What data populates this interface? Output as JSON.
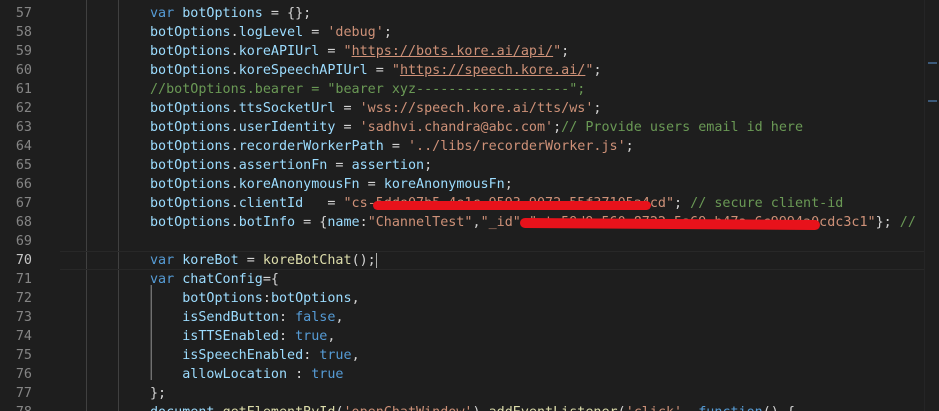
{
  "editor": {
    "first_line_number": 57,
    "active_line": 70,
    "lines": [
      {
        "n": "57",
        "tokens": [
          [
            "kw",
            "var"
          ],
          [
            "plain",
            " "
          ],
          [
            "var",
            "botOptions"
          ],
          [
            "plain",
            " = {};"
          ]
        ]
      },
      {
        "n": "58",
        "tokens": [
          [
            "var",
            "botOptions"
          ],
          [
            "plain",
            "."
          ],
          [
            "var",
            "logLevel"
          ],
          [
            "plain",
            " = "
          ],
          [
            "str",
            "'debug'"
          ],
          [
            "plain",
            ";"
          ]
        ]
      },
      {
        "n": "59",
        "tokens": [
          [
            "var",
            "botOptions"
          ],
          [
            "plain",
            "."
          ],
          [
            "var",
            "koreAPIUrl"
          ],
          [
            "plain",
            " = "
          ],
          [
            "str",
            "\""
          ],
          [
            "strurl",
            "https://bots.kore.ai/api/"
          ],
          [
            "str",
            "\""
          ],
          [
            "plain",
            ";"
          ]
        ]
      },
      {
        "n": "60",
        "tokens": [
          [
            "var",
            "botOptions"
          ],
          [
            "plain",
            "."
          ],
          [
            "var",
            "koreSpeechAPIUrl"
          ],
          [
            "plain",
            " = "
          ],
          [
            "str",
            "\""
          ],
          [
            "strurl",
            "https://speech.kore.ai/"
          ],
          [
            "str",
            "\""
          ],
          [
            "plain",
            ";"
          ]
        ]
      },
      {
        "n": "61",
        "tokens": [
          [
            "cmt",
            "//botOptions.bearer = \"bearer xyz-------------------\";"
          ]
        ]
      },
      {
        "n": "62",
        "tokens": [
          [
            "var",
            "botOptions"
          ],
          [
            "plain",
            "."
          ],
          [
            "var",
            "ttsSocketUrl"
          ],
          [
            "plain",
            " = "
          ],
          [
            "str",
            "'wss://speech.kore.ai/tts/ws'"
          ],
          [
            "plain",
            ";"
          ]
        ]
      },
      {
        "n": "63",
        "tokens": [
          [
            "var",
            "botOptions"
          ],
          [
            "plain",
            "."
          ],
          [
            "var",
            "userIdentity"
          ],
          [
            "plain",
            " = "
          ],
          [
            "str",
            "'sadhvi.chandra@abc.com'"
          ],
          [
            "plain",
            ";"
          ],
          [
            "cmt",
            "// Provide users email id here"
          ]
        ]
      },
      {
        "n": "64",
        "tokens": [
          [
            "var",
            "botOptions"
          ],
          [
            "plain",
            "."
          ],
          [
            "var",
            "recorderWorkerPath"
          ],
          [
            "plain",
            " = "
          ],
          [
            "str",
            "'../libs/recorderWorker.js'"
          ],
          [
            "plain",
            ";"
          ]
        ]
      },
      {
        "n": "65",
        "tokens": [
          [
            "var",
            "botOptions"
          ],
          [
            "plain",
            "."
          ],
          [
            "var",
            "assertionFn"
          ],
          [
            "plain",
            " = "
          ],
          [
            "var",
            "assertion"
          ],
          [
            "plain",
            ";"
          ]
        ]
      },
      {
        "n": "66",
        "tokens": [
          [
            "var",
            "botOptions"
          ],
          [
            "plain",
            "."
          ],
          [
            "var",
            "koreAnonymousFn"
          ],
          [
            "plain",
            " = "
          ],
          [
            "var",
            "koreAnonymousFn"
          ],
          [
            "plain",
            ";"
          ]
        ]
      },
      {
        "n": "67",
        "tokens": [
          [
            "var",
            "botOptions"
          ],
          [
            "plain",
            "."
          ],
          [
            "var",
            "clientId"
          ],
          [
            "plain",
            "   = "
          ],
          [
            "str",
            "\"cs-5dde07b5-4e1c-9593-9072-55f37105a4cd\""
          ],
          [
            "plain",
            "; "
          ],
          [
            "cmt",
            "// secure client-id"
          ]
        ]
      },
      {
        "n": "68",
        "tokens": [
          [
            "var",
            "botOptions"
          ],
          [
            "plain",
            "."
          ],
          [
            "var",
            "botInfo"
          ],
          [
            "plain",
            " = {"
          ],
          [
            "var",
            "name"
          ],
          [
            "plain",
            ":"
          ],
          [
            "str",
            "\"ChannelTest\""
          ],
          [
            "plain",
            ","
          ],
          [
            "str",
            "\"_id\""
          ],
          [
            "plain",
            ":"
          ],
          [
            "str",
            "\"st-59d9c560-8722-5a69-b47a-6c9994a0cdc3c1\""
          ],
          [
            "plain",
            "}; "
          ],
          [
            "cmt",
            "// bot na"
          ]
        ]
      },
      {
        "n": "69",
        "tokens": []
      },
      {
        "n": "70",
        "tokens": [
          [
            "kw",
            "var"
          ],
          [
            "plain",
            " "
          ],
          [
            "var",
            "koreBot"
          ],
          [
            "plain",
            " = "
          ],
          [
            "fn",
            "koreBotChat"
          ],
          [
            "plain",
            "();"
          ]
        ]
      },
      {
        "n": "71",
        "tokens": [
          [
            "kw",
            "var"
          ],
          [
            "plain",
            " "
          ],
          [
            "var",
            "chatConfig"
          ],
          [
            "plain",
            "={"
          ]
        ]
      },
      {
        "n": "72",
        "tokens": [
          [
            "plain",
            "    "
          ],
          [
            "var",
            "botOptions"
          ],
          [
            "plain",
            ":"
          ],
          [
            "var",
            "botOptions"
          ],
          [
            "plain",
            ","
          ]
        ]
      },
      {
        "n": "73",
        "tokens": [
          [
            "plain",
            "    "
          ],
          [
            "var",
            "isSendButton"
          ],
          [
            "plain",
            ": "
          ],
          [
            "kw",
            "false"
          ],
          [
            "plain",
            ","
          ]
        ]
      },
      {
        "n": "74",
        "tokens": [
          [
            "plain",
            "    "
          ],
          [
            "var",
            "isTTSEnabled"
          ],
          [
            "plain",
            ": "
          ],
          [
            "kw",
            "true"
          ],
          [
            "plain",
            ","
          ]
        ]
      },
      {
        "n": "75",
        "tokens": [
          [
            "plain",
            "    "
          ],
          [
            "var",
            "isSpeechEnabled"
          ],
          [
            "plain",
            ": "
          ],
          [
            "kw",
            "true"
          ],
          [
            "plain",
            ","
          ]
        ]
      },
      {
        "n": "76",
        "tokens": [
          [
            "plain",
            "    "
          ],
          [
            "var",
            "allowLocation"
          ],
          [
            "plain",
            " : "
          ],
          [
            "kw",
            "true"
          ]
        ]
      },
      {
        "n": "77",
        "tokens": [
          [
            "plain",
            "};"
          ]
        ]
      },
      {
        "n": "78",
        "tokens": [
          [
            "var",
            "document"
          ],
          [
            "plain",
            "."
          ],
          [
            "fn",
            "getElementById"
          ],
          [
            "plain",
            "("
          ],
          [
            "str",
            "'openChatWindow'"
          ],
          [
            "plain",
            ")."
          ],
          [
            "fn",
            "addEventListener"
          ],
          [
            "plain",
            "("
          ],
          [
            "str",
            "'click'"
          ],
          [
            "plain",
            ", "
          ],
          [
            "kw",
            "function"
          ],
          [
            "plain",
            "() {"
          ]
        ]
      }
    ]
  },
  "colors": {
    "background": "#1e1e1e",
    "keyword": "#569cd6",
    "variable": "#9cdcfe",
    "function": "#dcdcaa",
    "string": "#ce9178",
    "comment": "#6a9955",
    "redaction": "#e8121b"
  }
}
